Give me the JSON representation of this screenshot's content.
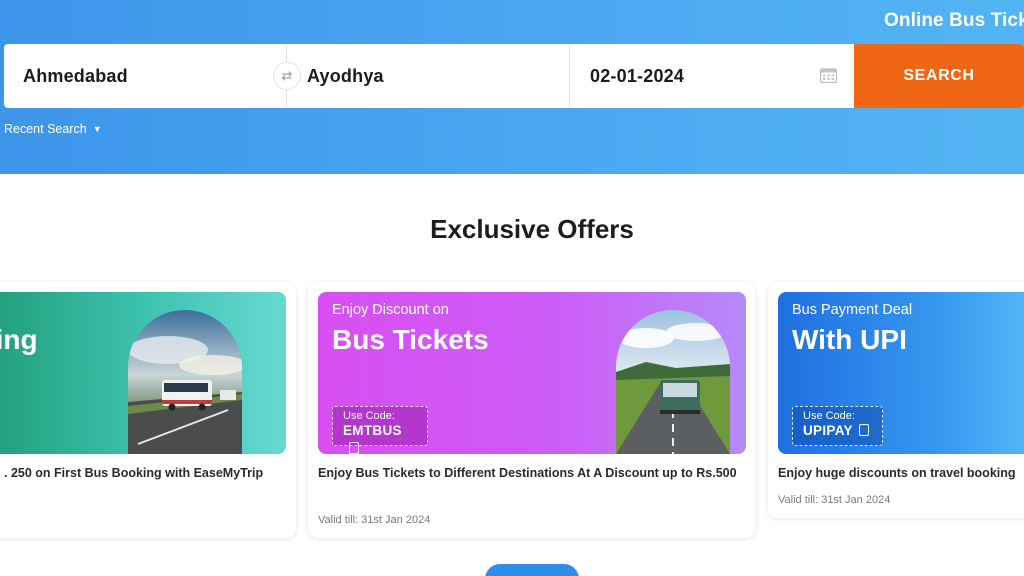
{
  "header": {
    "title": "Online Bus Tick",
    "from": "Ahmedabad",
    "to": "Ayodhya",
    "date": "02-01-2024",
    "search_label": "SEARCH",
    "recent_label": "Recent Search",
    "colors": {
      "hero": "#4aa8f1",
      "search_button": "#ef6614"
    },
    "icons": [
      "swap-icon",
      "calendar-icon",
      "caret-down-icon"
    ]
  },
  "offers": {
    "title": "Exclusive Offers",
    "cards": [
      {
        "banner_heading": "king",
        "description": ". 250 on First Bus Booking with EaseMyTrip"
      },
      {
        "banner_sub": "Enjoy Discount on",
        "banner_heading": "Bus Tickets",
        "code_label": "Use Code:",
        "code": "EMTBUS",
        "description": "Enjoy Bus Tickets to Different Destinations At A Discount up to Rs.500",
        "valid": "Valid till: 31st Jan 2024"
      },
      {
        "banner_sub": "Bus Payment Deal",
        "banner_heading": "With UPI",
        "code_label": "Use Code:",
        "code": "UPIPAY",
        "description": "Enjoy huge discounts on travel booking",
        "valid": "Valid till: 31st Jan 2024"
      }
    ]
  }
}
